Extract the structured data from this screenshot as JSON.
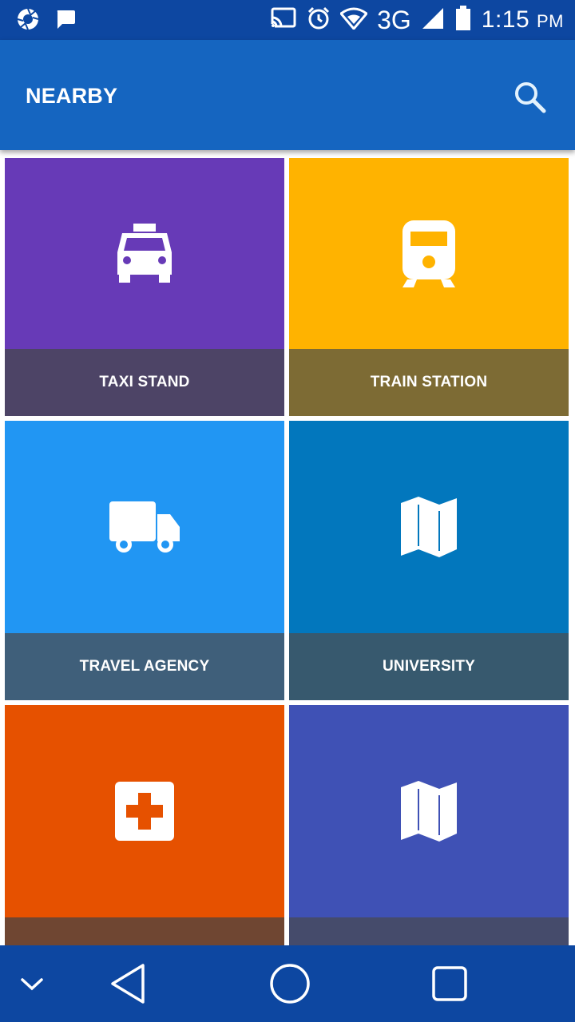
{
  "status_bar": {
    "network": "3G",
    "time": "1:15",
    "ampm": "PM",
    "icons": [
      "shutter-icon",
      "message-icon",
      "cast-icon",
      "alarm-icon",
      "wifi-icon",
      "signal-icon",
      "battery-icon"
    ]
  },
  "app_bar": {
    "title": "NEARBY",
    "search_icon": "search-icon"
  },
  "tiles": [
    {
      "label": "TAXI STAND",
      "icon": "taxi-icon",
      "color": "#673ab7",
      "label_color": "#4d4466"
    },
    {
      "label": "TRAIN STATION",
      "icon": "train-icon",
      "color": "#ffb300",
      "label_color": "#7d6b34"
    },
    {
      "label": "TRAVEL AGENCY",
      "icon": "truck-icon",
      "color": "#2196f3",
      "label_color": "#3f5f7a"
    },
    {
      "label": "UNIVERSITY",
      "icon": "map-icon",
      "color": "#0277bd",
      "label_color": "#37596e"
    },
    {
      "label": "",
      "icon": "medical-icon",
      "color": "#e65100",
      "label_color": "#6f4632"
    },
    {
      "label": "",
      "icon": "map-icon",
      "color": "#3f51b5",
      "label_color": "#454b6b"
    }
  ],
  "nav_bar": {
    "icons": [
      "chevron-down-icon",
      "back-icon",
      "home-icon",
      "recents-icon"
    ]
  }
}
